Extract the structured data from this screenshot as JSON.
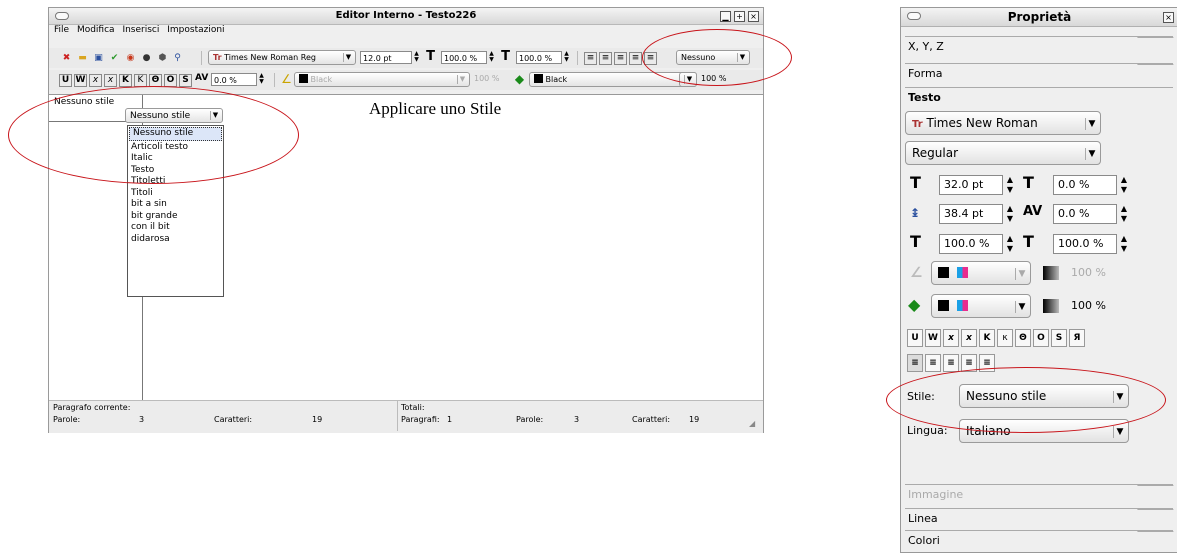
{
  "editor": {
    "title": "Editor Interno - Testo226",
    "menu": [
      "File",
      "Modifica",
      "Inserisci",
      "Impostazioni"
    ],
    "toolbar1": {
      "font": "Times New Roman Reg",
      "size": "12.0 pt",
      "scale_h": "100.0 %",
      "scale_v": "100.0 %",
      "style": "Nessuno"
    },
    "toolbar2": {
      "tracking": "0.0 %",
      "stroke_color": "Black",
      "stroke_shade": "100 %",
      "fill_color": "Black",
      "fill_shade": "100 %"
    },
    "style_column_value": "Nessuno stile",
    "style_combo": "Nessuno stile",
    "style_options": [
      "Nessuno stile",
      "Articoli testo",
      "Italic",
      "Testo",
      "Titoletti",
      "Titoli",
      "bit a sin",
      "bit grande",
      "con il bit",
      "didarosa"
    ],
    "text": "Applicare uno Stile",
    "status": {
      "current_paragraph_label": "Paragrafo corrente:",
      "words_label": "Parole:",
      "words_value": "3",
      "chars_label": "Caratteri:",
      "chars_value": "19",
      "totals_label": "Totali:",
      "paragraphs_label": "Paragrafi:",
      "paragraphs_value": "1",
      "tot_words_label": "Parole:",
      "tot_words_value": "3",
      "tot_chars_label": "Caratteri:",
      "tot_chars_value": "19"
    }
  },
  "props": {
    "title": "Proprietà",
    "tabs_top": [
      "X, Y, Z",
      "Forma",
      "Testo"
    ],
    "font": "Times New Roman",
    "font_style": "Regular",
    "size": "32.0 pt",
    "baseline_offset": "0.0 %",
    "line_spacing": "38.4 pt",
    "tracking": "0.0 %",
    "scale_h": "100.0 %",
    "scale_v": "100.0 %",
    "stroke_shade": "100 %",
    "fill_shade": "100 %",
    "style_label": "Stile:",
    "style_value": "Nessuno stile",
    "language_label": "Lingua:",
    "language_value": "Italiano",
    "tabs_bottom": [
      "Immagine",
      "Linea",
      "Colori"
    ]
  },
  "colors": {
    "annotation": "#c8151b"
  }
}
